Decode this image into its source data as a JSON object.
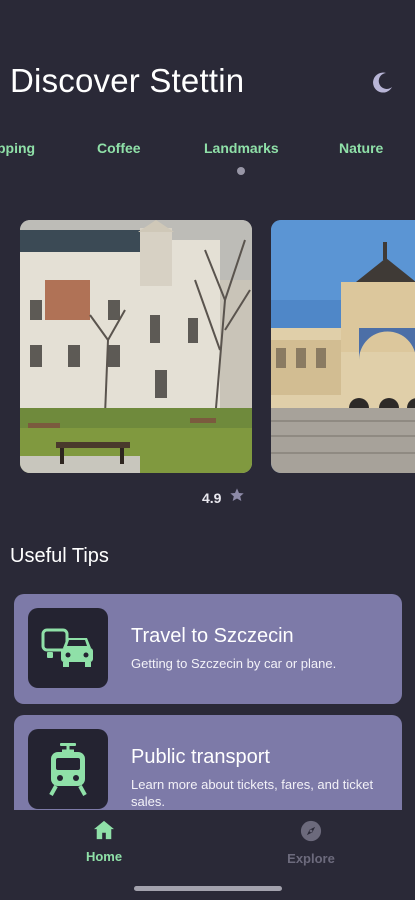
{
  "header": {
    "title": "Discover Stettin",
    "theme_toggle_icon": "moon-icon"
  },
  "categories": {
    "tabs": [
      {
        "label": "Shopping",
        "visible_text": "pping"
      },
      {
        "label": "Coffee"
      },
      {
        "label": "Landmarks",
        "selected": true
      },
      {
        "label": "Nature"
      }
    ]
  },
  "carousel": {
    "cards": [
      {
        "image": "palace-with-park-and-bench",
        "rating": "4.9",
        "rating_icon": "star-icon"
      },
      {
        "image": "art-nouveau-building-with-steps"
      }
    ]
  },
  "tips": {
    "title": "Useful Tips",
    "items": [
      {
        "title": "Travel to Szczecin",
        "description": "Getting to Szczecin by car or plane.",
        "icon": "cars-icon"
      },
      {
        "title": "Public transport",
        "description": "Learn more about tickets, fares, and ticket sales.",
        "icon": "tram-icon"
      }
    ]
  },
  "bottom_nav": {
    "items": [
      {
        "label": "Home",
        "icon": "home-icon",
        "active": true
      },
      {
        "label": "Explore",
        "icon": "compass-icon",
        "active": false
      }
    ]
  },
  "colors": {
    "background": "#2a2937",
    "accent": "#8fe0a8",
    "tip_card": "#7d7aa8",
    "icon_tile": "#242331",
    "muted": "#6c6a7c"
  }
}
